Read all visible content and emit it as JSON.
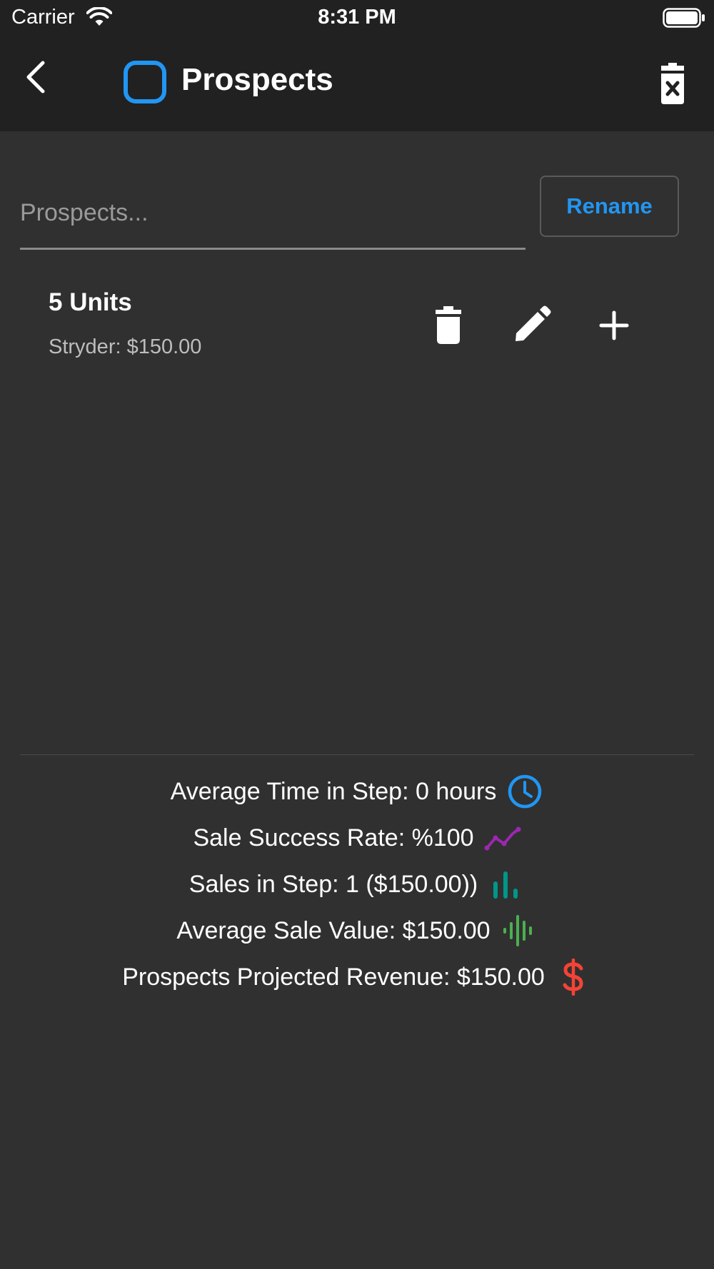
{
  "status_bar": {
    "carrier": "Carrier",
    "time": "8:31 PM"
  },
  "app_bar": {
    "title": "Prospects",
    "logo_icon": "rounded-square-outline-icon",
    "back_icon": "chevron-left-icon",
    "delete_icon": "trash-x-icon"
  },
  "rename": {
    "input_value": "",
    "placeholder": "Prospects...",
    "button_label": "Rename"
  },
  "item": {
    "title": "5 Units",
    "subtitle": "Stryder: $150.00",
    "actions": [
      "trash-icon",
      "pencil-icon",
      "plus-icon"
    ]
  },
  "stats": [
    {
      "label": "Average Time in Step: 0 hours",
      "icon": "clock-icon",
      "color": "#2196f3"
    },
    {
      "label": "Sale Success Rate: %100",
      "icon": "trending-line-icon",
      "color": "#9c27b0"
    },
    {
      "label": "Sales in Step: 1 ($150.00))",
      "icon": "bar-chart-icon",
      "color": "#009688"
    },
    {
      "label": "Average Sale Value: $150.00",
      "icon": "waveform-icon",
      "color": "#4caf50"
    },
    {
      "label": "Prospects Projected Revenue: $150.00",
      "icon": "dollar-icon",
      "color": "#f44336"
    }
  ],
  "colors": {
    "background": "#303030",
    "app_bar": "#212121",
    "accent": "#2196f3",
    "secondary_text": "#bdbdbd"
  }
}
